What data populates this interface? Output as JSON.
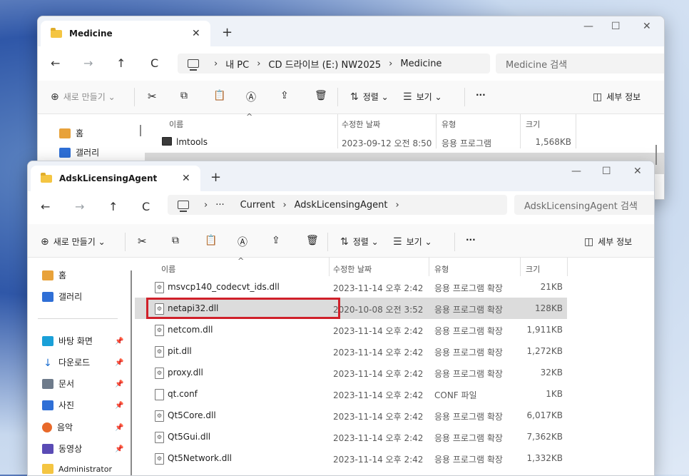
{
  "back_window": {
    "tab_title": "Medicine",
    "address": [
      "내 PC",
      "CD 드라이브 (E:) NW2025",
      "Medicine"
    ],
    "search_placeholder": "Medicine 검색",
    "toolbar": {
      "new": "새로 만들기",
      "sort": "정렬",
      "view": "보기",
      "more": "···",
      "details": "세부 정보"
    },
    "sidebar": [
      "홈",
      "갤러리"
    ],
    "columns": {
      "name": "이름",
      "date": "수정한 날짜",
      "type": "유형",
      "size": "크기"
    },
    "rows": [
      {
        "name": "lmtools",
        "date": "2023-09-12 오전 8:50",
        "type": "응용 프로그램",
        "size": "1,568KB"
      }
    ]
  },
  "front_window": {
    "tab_title": "AdskLicensingAgent",
    "address": [
      "···",
      "Current",
      "AdskLicensingAgent"
    ],
    "search_placeholder": "AdskLicensingAgent 검색",
    "toolbar": {
      "new": "새로 만들기",
      "sort": "정렬",
      "view": "보기",
      "more": "···",
      "details": "세부 정보"
    },
    "sidebar": {
      "home": "홈",
      "gallery": "갤러리",
      "quick": [
        "바탕 화면",
        "다운로드",
        "문서",
        "사진",
        "음악",
        "동영상",
        "Administrator"
      ]
    },
    "columns": {
      "name": "이름",
      "date": "수정한 날짜",
      "type": "유형",
      "size": "크기"
    },
    "rows": [
      {
        "name": "msvcp140_codecvt_ids.dll",
        "date": "2023-11-14 오후 2:42",
        "type": "응용 프로그램 확장",
        "size": "21KB"
      },
      {
        "name": "netapi32.dll",
        "date": "2020-10-08 오전 3:52",
        "type": "응용 프로그램 확장",
        "size": "128KB",
        "selected": true
      },
      {
        "name": "netcom.dll",
        "date": "2023-11-14 오후 2:42",
        "type": "응용 프로그램 확장",
        "size": "1,911KB"
      },
      {
        "name": "pit.dll",
        "date": "2023-11-14 오후 2:42",
        "type": "응용 프로그램 확장",
        "size": "1,272KB"
      },
      {
        "name": "proxy.dll",
        "date": "2023-11-14 오후 2:42",
        "type": "응용 프로그램 확장",
        "size": "32KB"
      },
      {
        "name": "qt.conf",
        "date": "2023-11-14 오후 2:42",
        "type": "CONF 파일",
        "size": "1KB"
      },
      {
        "name": "Qt5Core.dll",
        "date": "2023-11-14 오후 2:42",
        "type": "응용 프로그램 확장",
        "size": "6,017KB"
      },
      {
        "name": "Qt5Gui.dll",
        "date": "2023-11-14 오후 2:42",
        "type": "응용 프로그램 확장",
        "size": "7,362KB"
      },
      {
        "name": "Qt5Network.dll",
        "date": "2023-11-14 오후 2:42",
        "type": "응용 프로그램 확장",
        "size": "1,332KB"
      }
    ]
  },
  "colors": {
    "highlight": "#d0202a",
    "selected_row": "#dcdcdc",
    "folder": "#f4c542"
  }
}
